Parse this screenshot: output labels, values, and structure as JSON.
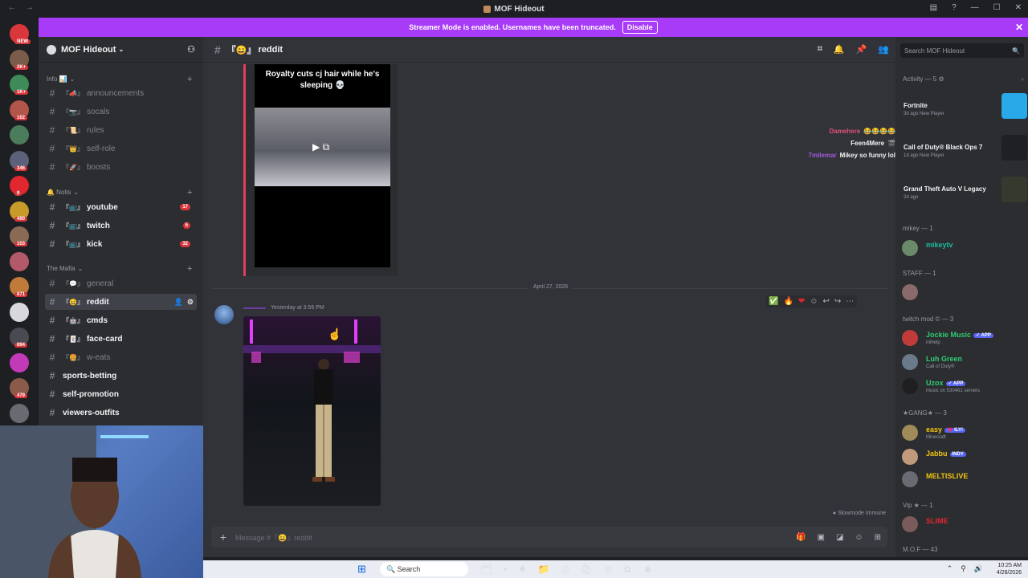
{
  "window": {
    "title": "MOF Hideout"
  },
  "banner": {
    "text": "Streamer Mode is enabled. Usernames have been truncated.",
    "button": "Disable"
  },
  "guilds": [
    {
      "badge": "NEW",
      "color": "#da373c"
    },
    {
      "badge": "2K+",
      "color": "#7a5c4a"
    },
    {
      "badge": "1K+",
      "color": "#3e8a58"
    },
    {
      "badge": "162",
      "color": "#b2554a"
    },
    {
      "badge": "",
      "color": "#4b7d5c"
    },
    {
      "badge": "346",
      "color": "#5c6078"
    },
    {
      "badge": "9",
      "color": "#e0262f"
    },
    {
      "badge": "490",
      "color": "#c89a2a"
    },
    {
      "badge": "103",
      "color": "#8a6a55"
    },
    {
      "badge": "",
      "color": "#b25a6a"
    },
    {
      "badge": "871",
      "color": "#c07a3a"
    },
    {
      "badge": "",
      "color": "#d8d8dc"
    },
    {
      "badge": "894",
      "color": "#4a4a52"
    },
    {
      "badge": "",
      "color": "#c23ab8"
    },
    {
      "badge": "479",
      "color": "#8a5a4a"
    },
    {
      "badge": "",
      "color": "#6a6a72"
    }
  ],
  "sidebar": {
    "server_name": "MOF Hideout",
    "categories": [
      {
        "label": "Info 📊"
      },
      {
        "label": "🔔 Notis"
      },
      {
        "label": "The Mafia"
      }
    ],
    "channels": [
      {
        "emoji": "『📣』",
        "name": "announcements",
        "count": ""
      },
      {
        "emoji": "『📷』",
        "name": "socals",
        "count": ""
      },
      {
        "emoji": "『📜』",
        "name": "rules",
        "count": ""
      },
      {
        "emoji": "『👑』",
        "name": "self-role",
        "count": ""
      },
      {
        "emoji": "『🚀』",
        "name": "boosts",
        "count": ""
      },
      {
        "emoji": "『📺』",
        "name": "youtube",
        "count": "17"
      },
      {
        "emoji": "『📺』",
        "name": "twitch",
        "count": "5"
      },
      {
        "emoji": "『📺』",
        "name": "kick",
        "count": "32"
      },
      {
        "emoji": "『💬』",
        "name": "general",
        "count": ""
      },
      {
        "emoji": "『😄』",
        "name": "reddit",
        "count": ""
      },
      {
        "emoji": "『🤖』",
        "name": "cmds",
        "count": ""
      },
      {
        "emoji": "『🃏』",
        "name": "face-card",
        "count": ""
      },
      {
        "emoji": "『🍔』",
        "name": "w-eats",
        "count": ""
      },
      {
        "emoji": "",
        "name": "sports-betting",
        "count": ""
      },
      {
        "emoji": "",
        "name": "self-promotion",
        "count": ""
      },
      {
        "emoji": "",
        "name": "viewers-outfits",
        "count": ""
      }
    ]
  },
  "chat": {
    "channel_emoji": "『😄』",
    "channel_name": "reddit",
    "embed_caption": "Royalty cuts cj hair while he's sleeping 💀",
    "live_chat": [
      {
        "name": "Damehere",
        "text": "😂😂😂😂",
        "color": "#e0527a"
      },
      {
        "name": "Feen4Mere",
        "text": "🎬",
        "color": "#f2f3f5"
      },
      {
        "name": "7milemar",
        "text": "Mikey so funny lol",
        "color": "#a35be0"
      }
    ],
    "date_divider": "April 27, 2026",
    "message_time": "Yesterday at 3:56 PM",
    "composer_placeholder": "Message #『😄』reddit",
    "slowmode": "Slowmode Immune"
  },
  "members": {
    "search_placeholder": "Search MOF Hideout",
    "activity_header": "Activity — 5",
    "activities": [
      {
        "game": "Fortnite",
        "sub": "3d ago  New Player",
        "color": "#2aa9e8"
      },
      {
        "game": "Call of Duty® Black Ops 7",
        "sub": "1d ago  New Player",
        "color": "#1f2024"
      },
      {
        "game": "Grand Theft Auto V Legacy",
        "sub": "2d ago",
        "color": "#35392e"
      }
    ],
    "groups": [
      {
        "label": "mikey — 1"
      },
      {
        "label": "STAFF — 1"
      },
      {
        "label": "twitch mod © — 3"
      },
      {
        "label": "★GANG★ — 3"
      },
      {
        "label": "Vip ★ — 1"
      },
      {
        "label": "M.O.F — 43"
      }
    ],
    "people": [
      {
        "name": "mikeytv",
        "status": "",
        "tag": "",
        "color": "#1abc9c",
        "av": "#6a8a6a"
      },
      {
        "name": "",
        "status": "",
        "tag": "",
        "color": "#3f4147",
        "av": "#8a6a6a"
      },
      {
        "name": "Jockie Music",
        "status": "mihelp",
        "tag": "✓ APP",
        "color": "#2ecc71",
        "av": "#c23b3b"
      },
      {
        "name": "Luh Green",
        "status": "Call of Duty®",
        "tag": "",
        "color": "#2ecc71",
        "av": "#6a7a8a"
      },
      {
        "name": "Uzox",
        "status": "music on 530461 servers",
        "tag": "✓ APP",
        "color": "#2ecc71",
        "av": "#1f1f22"
      },
      {
        "name": "easy",
        "status": "Minecraft",
        "tag": "💗 ILY!",
        "color": "#f1c40f",
        "av": "#a08a5a"
      },
      {
        "name": "Jabbu",
        "status": "",
        "tag": "INDY",
        "color": "#f1c40f",
        "av": "#c09a7a"
      },
      {
        "name": "MELTISLIVE",
        "status": "",
        "tag": "",
        "color": "#f1c40f",
        "av": "#6a6a72"
      },
      {
        "name": "SLIME",
        "status": "",
        "tag": "",
        "color": "#e0262f",
        "av": "#7a5a5a"
      }
    ]
  },
  "taskbar": {
    "search": "Search",
    "time": "10:25 AM",
    "date": "4/28/2026"
  }
}
